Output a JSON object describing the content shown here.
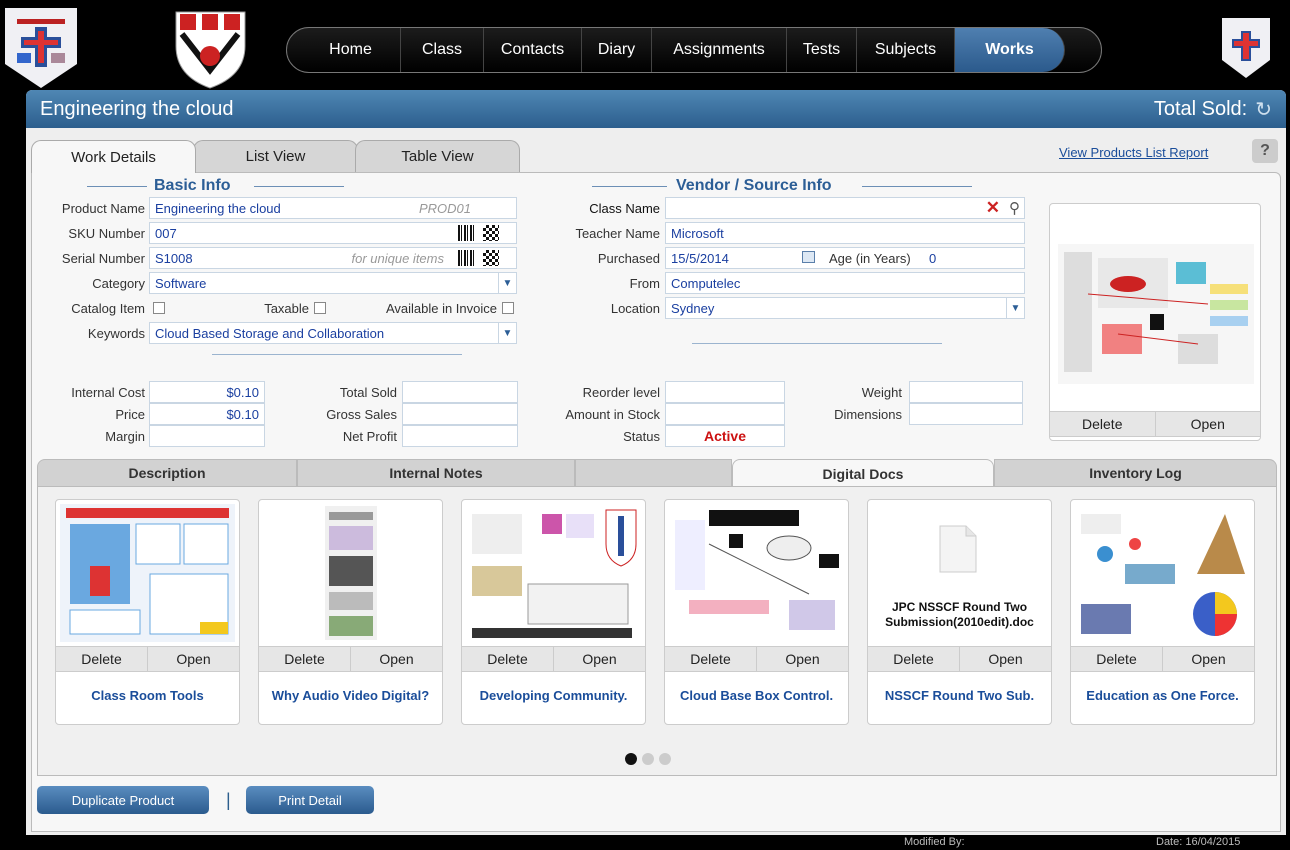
{
  "nav": {
    "items": [
      "Home",
      "Class",
      "Contacts",
      "Diary",
      "Assignments",
      "Tests",
      "Subjects",
      "Works"
    ],
    "active_index": 7
  },
  "header": {
    "title": "Engineering the cloud",
    "total_sold_label": "Total Sold:"
  },
  "tabs": [
    "Work Details",
    "List View",
    "Table View"
  ],
  "report_link": "View Products List Report",
  "help_label": "?",
  "basic_info": {
    "section_title": "Basic Info",
    "product_name_label": "Product Name",
    "product_name": "Engineering the cloud",
    "product_code": "PROD01",
    "sku_label": "SKU Number",
    "sku": "007",
    "serial_label": "Serial Number",
    "serial": "S1008",
    "serial_hint": "for unique items",
    "category_label": "Category",
    "category": "Software",
    "catalog_label": "Catalog Item",
    "taxable_label": "Taxable",
    "invoice_label": "Available in Invoice",
    "keywords_label": "Keywords",
    "keywords": "Cloud Based Storage and Collaboration"
  },
  "vendor_info": {
    "section_title": "Vendor / Source Info",
    "class_name_label": "Class Name",
    "class_name": "",
    "teacher_label": "Teacher Name",
    "teacher": "Microsoft",
    "purchased_label": "Purchased",
    "purchased": "15/5/2014",
    "age_label": "Age (in Years)",
    "age": "0",
    "from_label": "From",
    "from": "Computelec",
    "location_label": "Location",
    "location": "Sydney"
  },
  "financial": {
    "internal_cost_label": "Internal Cost",
    "internal_cost": "$0.10",
    "price_label": "Price",
    "price": "$0.10",
    "margin_label": "Margin",
    "margin": "",
    "total_sold_label": "Total Sold",
    "gross_sales_label": "Gross Sales",
    "net_profit_label": "Net Profit",
    "reorder_label": "Reorder level",
    "stock_label": "Amount in Stock",
    "status_label": "Status",
    "status": "Active",
    "weight_label": "Weight",
    "dimensions_label": "Dimensions"
  },
  "image_panel": {
    "delete_label": "Delete",
    "open_label": "Open"
  },
  "subtabs": [
    "Description",
    "Internal Notes",
    "",
    "Digital Docs",
    "Inventory Log"
  ],
  "subtab_active": 3,
  "docs": [
    {
      "title": "Class Room Tools",
      "delete": "Delete",
      "open": "Open",
      "thumb_text": ""
    },
    {
      "title": "Why Audio Video Digital?",
      "delete": "Delete",
      "open": "Open",
      "thumb_text": ""
    },
    {
      "title": "Developing Community.",
      "delete": "Delete",
      "open": "Open",
      "thumb_text": ""
    },
    {
      "title": "Cloud Base Box Control.",
      "delete": "Delete",
      "open": "Open",
      "thumb_text": ""
    },
    {
      "title": "NSSCF Round Two Sub.",
      "delete": "Delete",
      "open": "Open",
      "thumb_text": "JPC NSSCF Round Two Submission(2010edit).doc"
    },
    {
      "title": "Education as One Force.",
      "delete": "Delete",
      "open": "Open",
      "thumb_text": ""
    }
  ],
  "buttons": {
    "duplicate": "Duplicate Product",
    "separator": "|",
    "print": "Print Detail"
  },
  "footer": {
    "modified": "Modified By:",
    "date": "Date:  16/04/2015"
  },
  "colors": {
    "accent": "#2c5e8d",
    "status_active": "#cc1111",
    "link": "#1a4d9a"
  }
}
